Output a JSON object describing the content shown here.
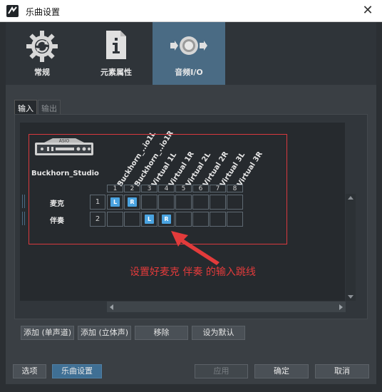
{
  "window": {
    "title": "乐曲设置",
    "close_label": "✕"
  },
  "main_tabs": [
    {
      "label": "常规",
      "icon": "gear-icon"
    },
    {
      "label": "元素属性",
      "icon": "document-icon"
    },
    {
      "label": "音频I/O",
      "icon": "audio-io-icon"
    }
  ],
  "sub_tabs": [
    {
      "label": "输入"
    },
    {
      "label": "输出"
    }
  ],
  "device": {
    "badge": "ASIO",
    "name": "Buckhorn_Studio"
  },
  "columns": [
    {
      "num": "1",
      "label": "Buckhorn_..io1L"
    },
    {
      "num": "2",
      "label": "Buckhorn_..io1R"
    },
    {
      "num": "3",
      "label": "Virtual 1L"
    },
    {
      "num": "4",
      "label": "Virtual 1R"
    },
    {
      "num": "5",
      "label": "Virtual 2L"
    },
    {
      "num": "6",
      "label": "Virtual 2R"
    },
    {
      "num": "7",
      "label": "Virtual 3L"
    },
    {
      "num": "8",
      "label": "Virtual 3R"
    }
  ],
  "rows": [
    {
      "label": "麦克",
      "num": "1",
      "assigned": {
        "1": "L",
        "2": "R"
      }
    },
    {
      "label": "伴奏",
      "num": "2",
      "assigned": {
        "3": "L",
        "4": "R"
      }
    }
  ],
  "annotation": "设置好麦克 伴奏 的输入跳线",
  "buttons": {
    "add_mono": "添加 (单声道)",
    "add_stereo": "添加 (立体声)",
    "remove": "移除",
    "set_default": "设为默认",
    "options": "选项",
    "song_settings": "乐曲设置",
    "apply": "应用",
    "ok": "确定",
    "cancel": "取消"
  },
  "colors": {
    "accent": "#4a6b84",
    "highlight_red": "#d9393e",
    "assign_blue": "#4aa3e0"
  }
}
